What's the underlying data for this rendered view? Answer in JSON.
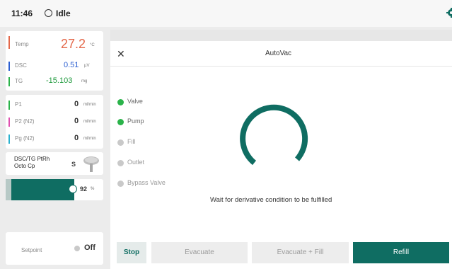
{
  "status_bar": {
    "time": "11:46",
    "state": "Idle"
  },
  "sidebar": {
    "temperature": {
      "label": "Temp",
      "value": "27.2",
      "unit": "°C",
      "color": "#e4684a"
    },
    "signals": [
      {
        "label": "DSC",
        "value": "0.51",
        "unit": "µV",
        "color": "#2c5fd1",
        "value_color": "#2c5fd1"
      },
      {
        "label": "TG",
        "value": "-15.103",
        "unit": "mg",
        "color": "#2bb34a",
        "value_color": "#1f9a3d"
      }
    ],
    "flows": [
      {
        "label": "P1",
        "value": "0",
        "unit": "ml/min",
        "color": "#2bb34a"
      },
      {
        "label": "P2 (N2)",
        "value": "0",
        "unit": "ml/min",
        "color": "#e04fb0"
      },
      {
        "label": "Pg (N2)",
        "value": "0",
        "unit": "ml/min",
        "color": "#2ab2cf"
      }
    ],
    "crucible": {
      "name": "DSC/TG PtRh Octo Cp",
      "badge": "S"
    },
    "progress": {
      "value": "92",
      "unit": "%",
      "fraction": 0.85
    },
    "setpoint": {
      "label": "Setpoint",
      "value": "Off"
    }
  },
  "dialog": {
    "title": "AutoVac",
    "steps": [
      {
        "label": "Valve",
        "active": true
      },
      {
        "label": "Pump",
        "active": true
      },
      {
        "label": "Fill",
        "active": false
      },
      {
        "label": "Outlet",
        "active": false
      },
      {
        "label": "Bypass Valve",
        "active": false
      }
    ],
    "status_message": "Wait for derivative condition to be fulfilled",
    "buttons": {
      "stop": "Stop",
      "evacuate": "Evacuate",
      "evacuate_fill": "Evacuate + Fill",
      "refill": "Refill"
    }
  },
  "colors": {
    "accent": "#0f6d62",
    "active_step": "#2bb34a",
    "inactive_step": "#c9c9c9"
  },
  "icons": {
    "idle": "circle-icon",
    "settings": "gear-icon",
    "close": "close-icon"
  }
}
